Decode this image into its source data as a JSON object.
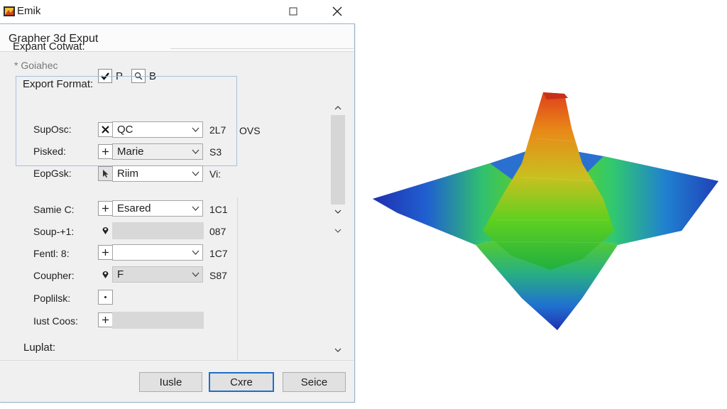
{
  "window": {
    "app_title": "Emik",
    "icons": {
      "app": "app-logo-icon",
      "maximize": "maximize-icon",
      "close": "close-icon"
    }
  },
  "dialog": {
    "title": "Grapher 3d Exput",
    "row1": {
      "label": "Expant Cotwat:",
      "opt1": "P",
      "opt2": "B"
    },
    "hint": "* Goiahec",
    "group_label": "Export Format:",
    "rows": [
      {
        "label": "SupOsc:",
        "button_icon": "close-x-icon",
        "combo": "QC",
        "value": "2L7",
        "extra": "OVS"
      },
      {
        "label": "Pisked:",
        "button_icon": "plus-icon",
        "combo": "Marie",
        "value": "S3"
      },
      {
        "label": "EopGsk:",
        "button_icon": "cursor-icon",
        "combo": "Riim",
        "value": "Vi:"
      },
      {
        "label": "Samie C:",
        "button_icon": "plus-icon",
        "combo": "Esared",
        "value": "1C1"
      },
      {
        "label": "Soup-+1:",
        "button_icon": "pin-icon",
        "combo": "",
        "value": "087"
      },
      {
        "label": "Fentl: 8:",
        "button_icon": "plus-icon",
        "combo": "",
        "value": "1C7"
      },
      {
        "label": "Coupher:",
        "button_icon": "pin-icon",
        "combo": "F",
        "value": "S87"
      },
      {
        "label": "Poplilsk:",
        "button_icon": "dot-icon",
        "combo": "",
        "value": ""
      },
      {
        "label": "Iust Coos:",
        "button_icon": "plus-icon",
        "combo": "",
        "value": ""
      }
    ],
    "footer_label": "Luplat:",
    "buttons": {
      "left": "Iusle",
      "middle": "Cxre",
      "right": "Seice"
    }
  },
  "colors": {
    "accent": "#1e6ec9",
    "frame": "#a8c0dc",
    "dialog_bg": "#f0f0f0",
    "surface_peak": "#e0401a",
    "surface_mid": "#5fd020",
    "surface_low": "#2030b0"
  }
}
